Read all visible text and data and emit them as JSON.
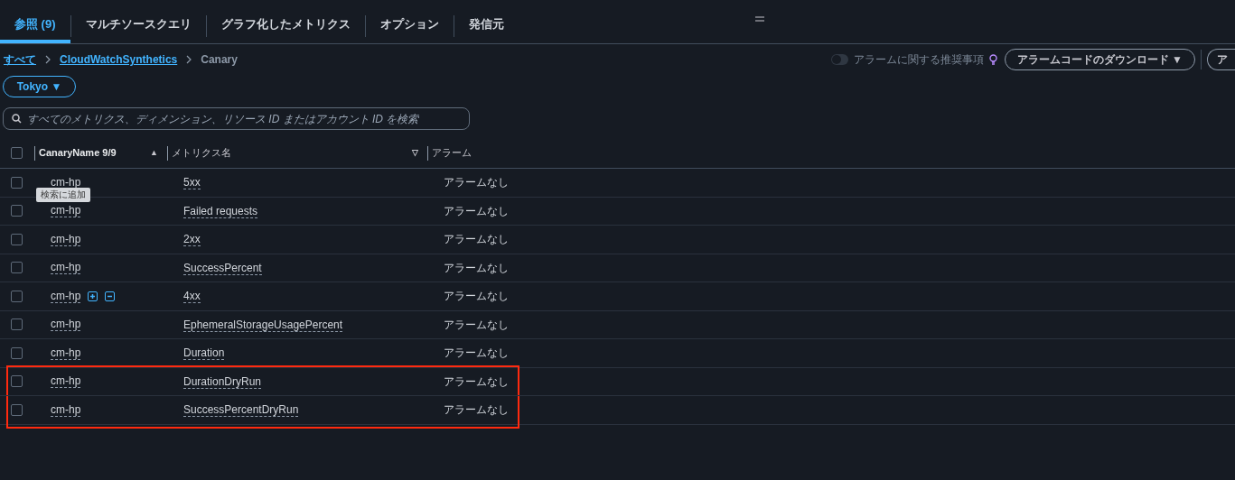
{
  "tabs": [
    {
      "label": "参照 (9)",
      "selected": true
    },
    {
      "label": "マルチソースクエリ",
      "selected": false
    },
    {
      "label": "グラフ化したメトリクス",
      "selected": false
    },
    {
      "label": "オプション",
      "selected": false
    },
    {
      "label": "発信元",
      "selected": false
    }
  ],
  "breadcrumb": [
    {
      "label": "すべて",
      "link": true
    },
    {
      "label": "CloudWatchSynthetics",
      "link": true
    },
    {
      "label": "Canary",
      "link": false
    }
  ],
  "alarm_recommendations": {
    "label": "アラームに関する推奨事項",
    "on": false
  },
  "download_button": "アラームコードのダウンロード ▼",
  "cut_button": "ア",
  "region_button": "Tokyo ▼",
  "search": {
    "placeholder": "すべてのメトリクス、ディメンション、リソース ID またはアカウント ID を検索"
  },
  "table": {
    "select_all_checked": false,
    "columns": [
      {
        "label": "CanaryName 9/9",
        "sort": "▲"
      },
      {
        "label": "メトリクス名",
        "sort": "▽"
      },
      {
        "label": "アラーム"
      }
    ],
    "rows": [
      {
        "canary": "cm-hp",
        "metric": "5xx",
        "alarm": "アラームなし",
        "checked": false,
        "tooltip": "検索に追加",
        "actions": false,
        "highlighted": false
      },
      {
        "canary": "cm-hp",
        "metric": "Failed requests",
        "alarm": "アラームなし",
        "checked": false,
        "actions": false,
        "highlighted": false
      },
      {
        "canary": "cm-hp",
        "metric": "2xx",
        "alarm": "アラームなし",
        "checked": false,
        "actions": false,
        "highlighted": false
      },
      {
        "canary": "cm-hp",
        "metric": "SuccessPercent",
        "alarm": "アラームなし",
        "checked": false,
        "actions": false,
        "highlighted": false
      },
      {
        "canary": "cm-hp",
        "metric": "4xx",
        "alarm": "アラームなし",
        "checked": false,
        "actions": true,
        "highlighted": false
      },
      {
        "canary": "cm-hp",
        "metric": "EphemeralStorageUsagePercent",
        "alarm": "アラームなし",
        "checked": false,
        "actions": false,
        "highlighted": false
      },
      {
        "canary": "cm-hp",
        "metric": "Duration",
        "alarm": "アラームなし",
        "checked": false,
        "actions": false,
        "highlighted": false
      },
      {
        "canary": "cm-hp",
        "metric": "DurationDryRun",
        "alarm": "アラームなし",
        "checked": false,
        "actions": false,
        "highlighted": true
      },
      {
        "canary": "cm-hp",
        "metric": "SuccessPercentDryRun",
        "alarm": "アラームなし",
        "checked": false,
        "actions": false,
        "highlighted": true
      }
    ]
  }
}
